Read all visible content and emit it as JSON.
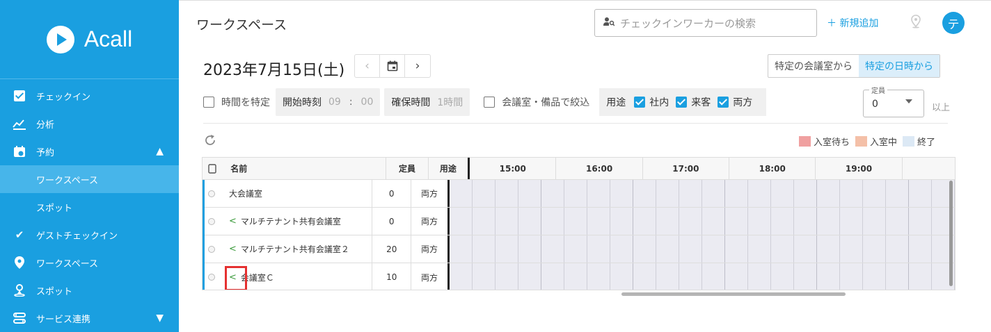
{
  "sidebar": {
    "logo_text": "Acall",
    "items": [
      {
        "label": "チェックイン",
        "icon": "checkbox-icon"
      },
      {
        "label": "分析",
        "icon": "chart-icon"
      },
      {
        "label": "予約",
        "icon": "calendar-icon"
      },
      {
        "label": "ワークスペース",
        "icon": "",
        "active": true
      },
      {
        "label": "スポット",
        "icon": ""
      },
      {
        "label": "ゲストチェックイン",
        "icon": "check-icon"
      },
      {
        "label": "ワークスペース",
        "icon": "map-pin-icon"
      },
      {
        "label": "スポット",
        "icon": "person-pin-icon"
      },
      {
        "label": "サービス連携",
        "icon": "integration-icon"
      }
    ]
  },
  "header": {
    "title": "ワークスペース",
    "search_placeholder": "チェックインワーカーの検索",
    "new_label": "＋ 新規追加",
    "avatar_initial": "テ"
  },
  "date_bar": {
    "date": "2023年7月15日(土)",
    "prev": "‹",
    "cal": "▣",
    "next": "›"
  },
  "mode": {
    "option1": "特定の会議室から",
    "option2": "特定の日時から"
  },
  "filters": {
    "specify_time": "時間を特定",
    "start_label": "開始時刻",
    "start_hour": "09",
    "sep": ":",
    "start_min": "00",
    "duration_label": "確保時間",
    "duration_value": "1時間",
    "narrow": "会議室・備品で絞込",
    "usage_label": "用途",
    "usage_internal": "社内",
    "usage_visitor": "来客",
    "usage_both": "両方",
    "capacity_label": "定員",
    "capacity_value": "0",
    "capacity_suffix": "以上"
  },
  "legend": {
    "waiting": "入室待ち",
    "in_room": "入室中",
    "ended": "終了",
    "colors": {
      "waiting": "#f0a0a0",
      "in_room": "#f4c0a8",
      "ended": "#dce9f5"
    }
  },
  "table": {
    "headers": {
      "name": "名前",
      "capacity": "定員",
      "usage": "用途"
    },
    "hours": [
      "15:00",
      "16:00",
      "17:00",
      "18:00",
      "19:00",
      ""
    ],
    "rows": [
      {
        "name": "大会議室",
        "shared": false,
        "capacity": "0",
        "usage": "両方"
      },
      {
        "name": "マルチテナント共有会議室",
        "shared": true,
        "capacity": "0",
        "usage": "両方"
      },
      {
        "name": "マルチテナント共有会議室２",
        "shared": true,
        "capacity": "20",
        "usage": "両方"
      },
      {
        "name": "会議室Ｃ",
        "shared": true,
        "capacity": "10",
        "usage": "両方"
      }
    ]
  }
}
